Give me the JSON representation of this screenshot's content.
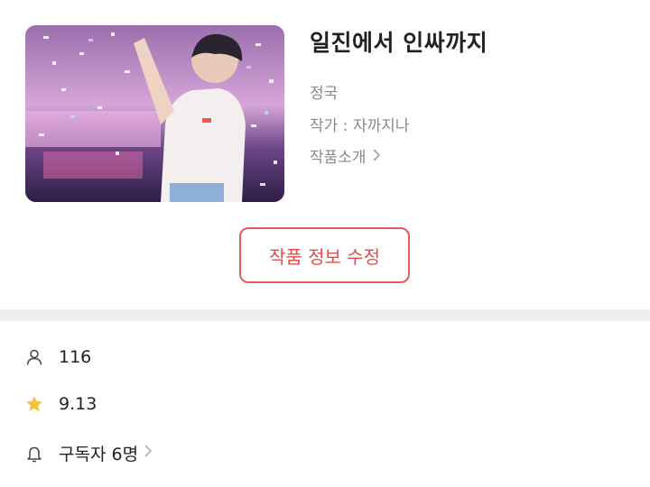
{
  "work": {
    "title": "일진에서 인싸까지",
    "cast": "정국",
    "author": "작가 : 자까지나",
    "intro_label": "작품소개",
    "cover_icon": "cover-image"
  },
  "actions": {
    "edit_label": "작품 정보 수정"
  },
  "stats": {
    "views": "116",
    "rating": "9.13",
    "subscribers": "구독자 6명"
  },
  "colors": {
    "accent": "#e25c5c",
    "star": "#f7c23a",
    "divider": "#eeeff1"
  }
}
